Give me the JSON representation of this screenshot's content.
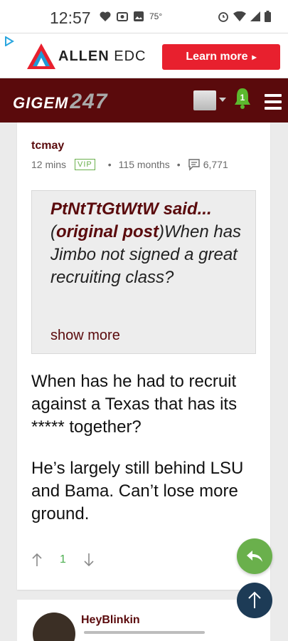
{
  "status": {
    "time": "12:57",
    "temp": "75°"
  },
  "ad": {
    "brand_bold": "ALLEN",
    "brand_rest": " EDC",
    "cta": "Learn more"
  },
  "site": {
    "logo_text": "GIGEM",
    "logo_num": "247",
    "notification_count": "1"
  },
  "post": {
    "author": "tcmay",
    "time_ago": "12 mins",
    "badge": "VIP",
    "tenure": "115 months",
    "post_count": "6,771",
    "quote": {
      "user_said": "PtNtTtGtWtW said...",
      "original_link": "original post",
      "text": "When has Jimbo not signed a great recruiting class?",
      "show_more": "show more"
    },
    "paragraphs": [
      "When has he had to recruit against a Texas that has its ***** together?",
      "He’s largely still behind LSU and Bama. Can’t lose more ground."
    ],
    "votes": "1"
  },
  "next_post": {
    "author": "HeyBlinkin"
  },
  "colors": {
    "maroon": "#5a0a0c",
    "green": "#6ab04c",
    "navy": "#1d3b56",
    "ad_red": "#e8202e"
  }
}
